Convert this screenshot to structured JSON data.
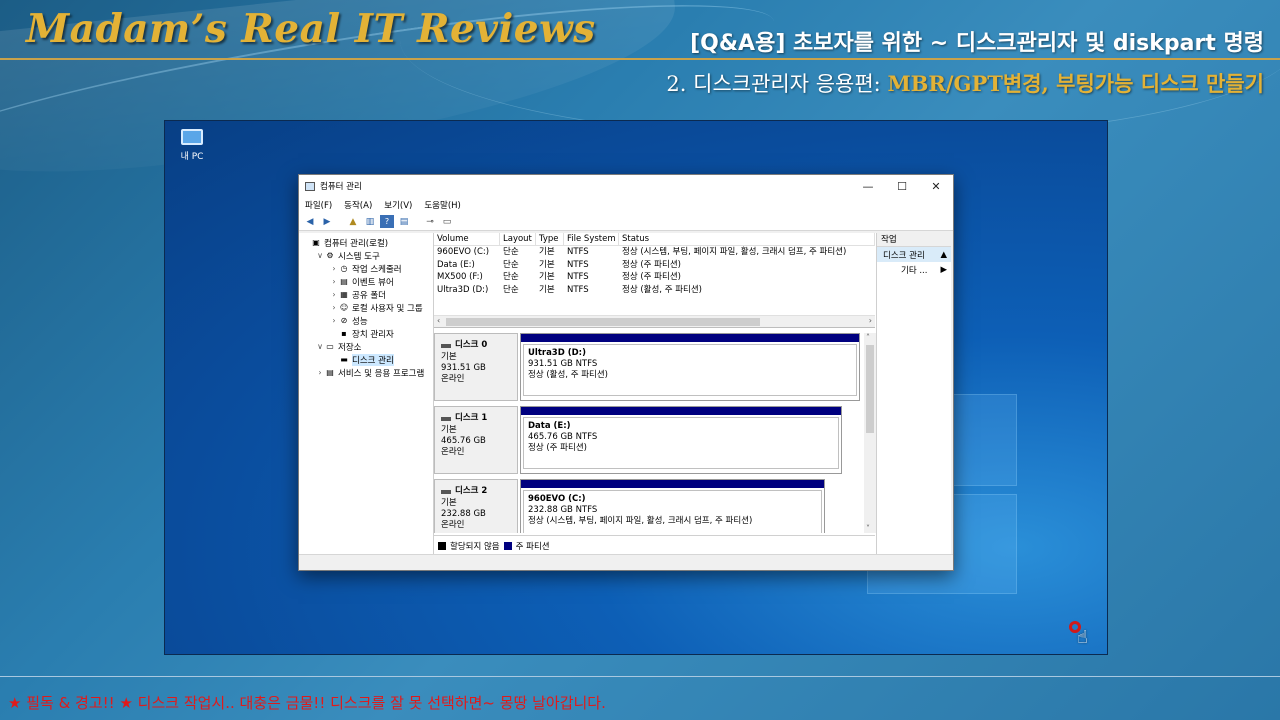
{
  "header": {
    "brand": "Madam’s Real IT Reviews",
    "title": "[Q&A용] 초보자를 위한 ~ 디스크관리자 및 diskpart 명령",
    "subtitle_prefix": "2. 디스크관리자 응용편: ",
    "subtitle_highlight": "MBR/GPT변경, 부팅가능 디스크 만들기"
  },
  "desktop": {
    "icon_label": "내 PC"
  },
  "window": {
    "title": "컴퓨터 관리",
    "controls": {
      "minimize": "—",
      "maximize": "☐",
      "close": "✕"
    },
    "menu": [
      "파일(F)",
      "동작(A)",
      "보기(V)",
      "도움말(H)"
    ],
    "tree": [
      {
        "label": "컴퓨터 관리(로컬)",
        "level": 0,
        "exp": "",
        "icon": "▣"
      },
      {
        "label": "시스템 도구",
        "level": 1,
        "exp": "∨",
        "icon": "⚙"
      },
      {
        "label": "작업 스케줄러",
        "level": 2,
        "exp": "›",
        "icon": "◷"
      },
      {
        "label": "이벤트 뷰어",
        "level": 2,
        "exp": "›",
        "icon": "▤"
      },
      {
        "label": "공유 폴더",
        "level": 2,
        "exp": "›",
        "icon": "▦"
      },
      {
        "label": "로컬 사용자 및 그룹",
        "level": 2,
        "exp": "›",
        "icon": "☺"
      },
      {
        "label": "성능",
        "level": 2,
        "exp": "›",
        "icon": "⊘"
      },
      {
        "label": "장치 관리자",
        "level": 2,
        "exp": "",
        "icon": "▪"
      },
      {
        "label": "저장소",
        "level": 1,
        "exp": "∨",
        "icon": "▭"
      },
      {
        "label": "디스크 관리",
        "level": 2,
        "exp": "",
        "icon": "▬",
        "selected": true
      },
      {
        "label": "서비스 및 응용 프로그램",
        "level": 1,
        "exp": "›",
        "icon": "▤"
      }
    ],
    "volume_table": {
      "headers": [
        "Volume",
        "Layout",
        "Type",
        "File System",
        "Status"
      ],
      "rows": [
        [
          "960EVO (C:)",
          "단순",
          "기본",
          "NTFS",
          "정상 (시스템, 부팅, 페이지 파일, 활성, 크래시 덤프, 주 파티션)"
        ],
        [
          "Data (E:)",
          "단순",
          "기본",
          "NTFS",
          "정상 (주 파티션)"
        ],
        [
          "MX500 (F:)",
          "단순",
          "기본",
          "NTFS",
          "정상 (주 파티션)"
        ],
        [
          "Ultra3D (D:)",
          "단순",
          "기본",
          "NTFS",
          "정상 (활성, 주 파티션)"
        ]
      ]
    },
    "disks": [
      {
        "name": "디스크 0",
        "type": "기본",
        "size": "931.51 GB",
        "state": "온라인",
        "partition": {
          "name": "Ultra3D  (D:)",
          "detail": "931.51 GB NTFS",
          "status": "정상 (활성, 주 파티션)"
        }
      },
      {
        "name": "디스크 1",
        "type": "기본",
        "size": "465.76 GB",
        "state": "온라인",
        "partition": {
          "name": "Data  (E:)",
          "detail": "465.76 GB NTFS",
          "status": "정상 (주 파티션)"
        }
      },
      {
        "name": "디스크 2",
        "type": "기본",
        "size": "232.88 GB",
        "state": "온라인",
        "partition": {
          "name": "960EVO  (C:)",
          "detail": "232.88 GB NTFS",
          "status": "정상 (시스템, 부팅, 페이지 파일, 활성, 크래시 덤프, 주 파티션)"
        }
      }
    ],
    "legend": {
      "unallocated": "할당되지 않음",
      "primary": "주 파티션",
      "unallocated_color": "#000000",
      "primary_color": "#00007f"
    },
    "actions": {
      "header": "작업",
      "selected": "디스크 관리",
      "more": "기타 ..."
    }
  },
  "footer": {
    "warning": "★ 필독 & 경고!! ★ 디스크 작업시.. 대충은 금물!!  디스크를  잘 못 선택하면~ 몽땅 날아갑니다."
  },
  "colors": {
    "brand": "#e3b236",
    "warning": "#e11a1a",
    "partition_bar": "#00007f"
  }
}
